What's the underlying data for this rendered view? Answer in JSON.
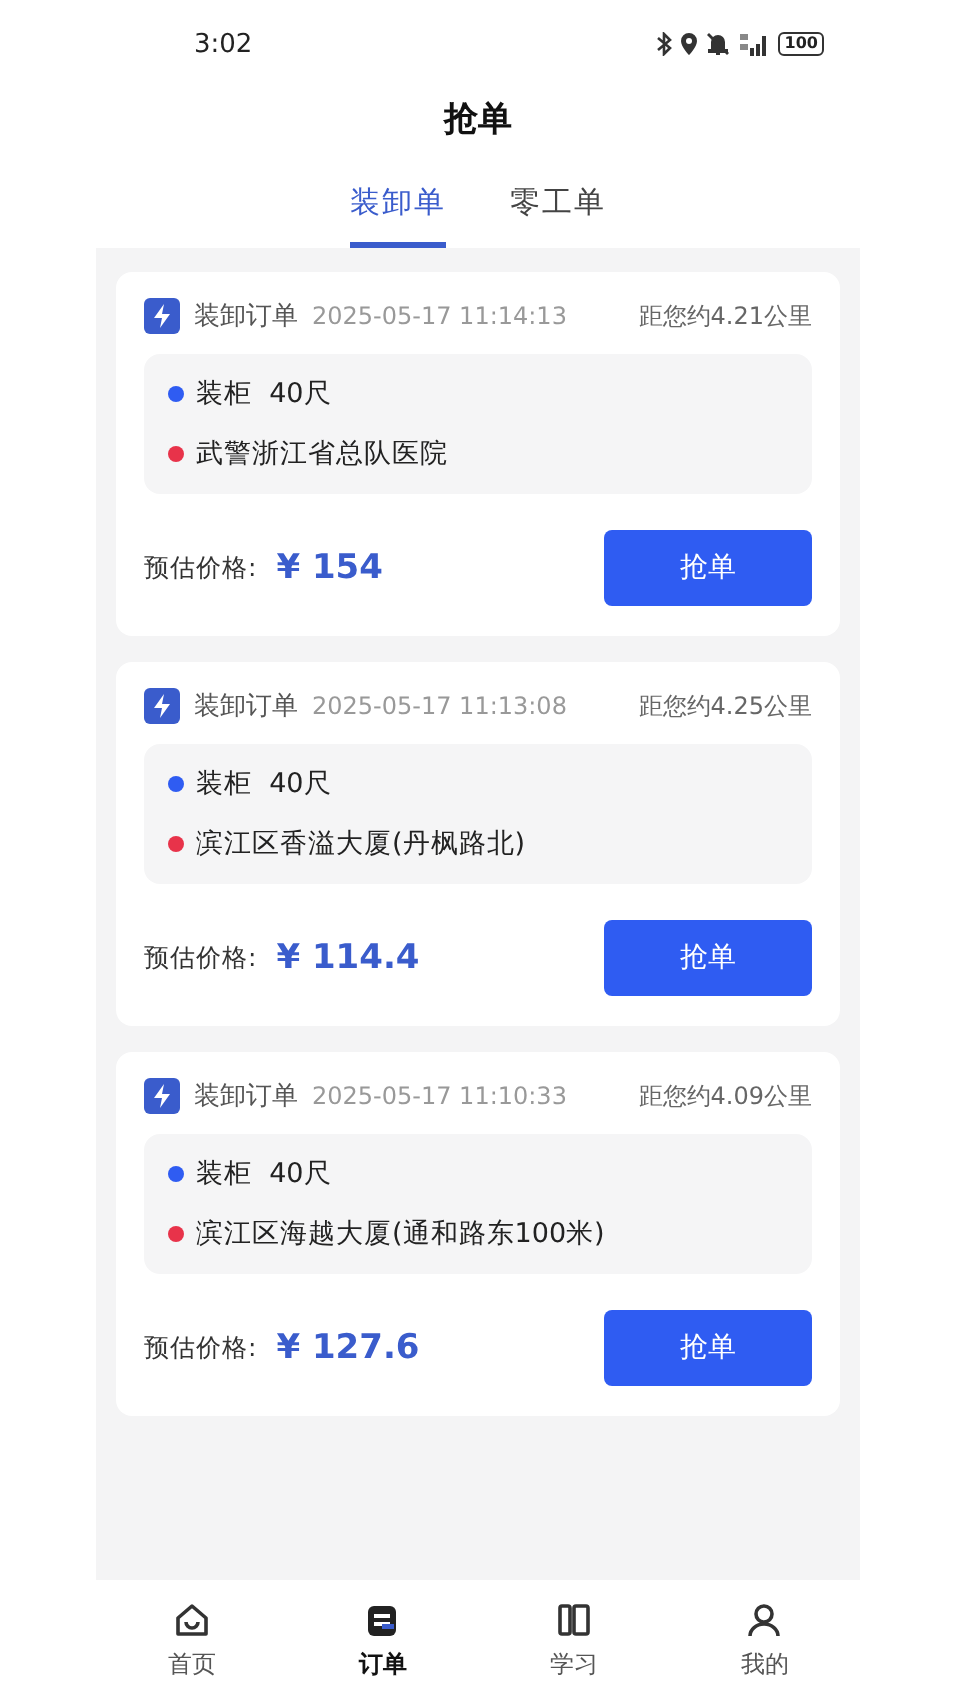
{
  "status_bar": {
    "time": "3:02",
    "battery": "100"
  },
  "title": "抢单",
  "tabs": [
    {
      "label": "装卸单",
      "selected": true
    },
    {
      "label": "零工单",
      "selected": false
    }
  ],
  "orders": [
    {
      "type": "装卸订单",
      "time": "2025-05-17 11:14:13",
      "distance": "距您约4.21公里",
      "cargo": "装柜  40尺",
      "destination": "武警浙江省总队医院",
      "price_label": "预估价格:",
      "price": "¥ 154",
      "action": "抢单"
    },
    {
      "type": "装卸订单",
      "time": "2025-05-17 11:13:08",
      "distance": "距您约4.25公里",
      "cargo": "装柜  40尺",
      "destination": "滨江区香溢大厦(丹枫路北)",
      "price_label": "预估价格:",
      "price": "¥ 114.4",
      "action": "抢单"
    },
    {
      "type": "装卸订单",
      "time": "2025-05-17 11:10:33",
      "distance": "距您约4.09公里",
      "cargo": "装柜  40尺",
      "destination": "滨江区海越大厦(通和路东100米)",
      "price_label": "预估价格:",
      "price": "¥ 127.6",
      "action": "抢单"
    }
  ],
  "nav": [
    {
      "label": "首页",
      "selected": false
    },
    {
      "label": "订单",
      "selected": true
    },
    {
      "label": "学习",
      "selected": false
    },
    {
      "label": "我的",
      "selected": false
    }
  ]
}
